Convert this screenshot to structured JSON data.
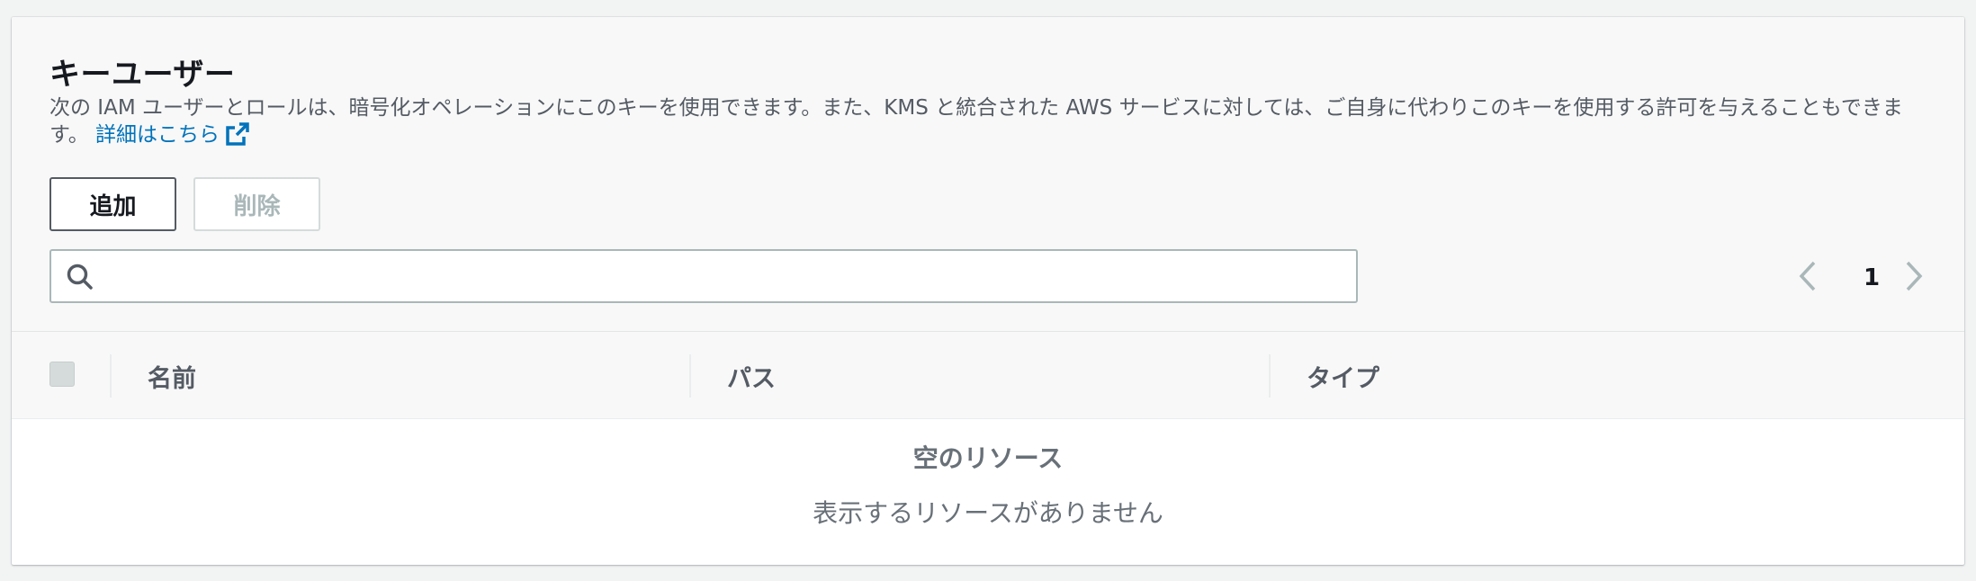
{
  "section": {
    "title": "キーユーザー",
    "description": "次の IAM ユーザーとロールは、暗号化オペレーションにこのキーを使用できます。また、KMS と統合された AWS サービスに対しては、ご自身に代わりこのキーを使用する許可を与えることもできます。",
    "learn_more_label": "詳細はこちら"
  },
  "actions": {
    "add_label": "追加",
    "remove_label": "削除"
  },
  "search": {
    "value": "",
    "placeholder": ""
  },
  "pagination": {
    "current_page": "1"
  },
  "table": {
    "columns": [
      "名前",
      "パス",
      "タイプ"
    ],
    "rows": [],
    "empty_title": "空のリソース",
    "empty_message": "表示するリソースがありません"
  },
  "colors": {
    "link": "#0073bb",
    "header_bg": "#f8f8f8",
    "border": "#aab7b8"
  }
}
